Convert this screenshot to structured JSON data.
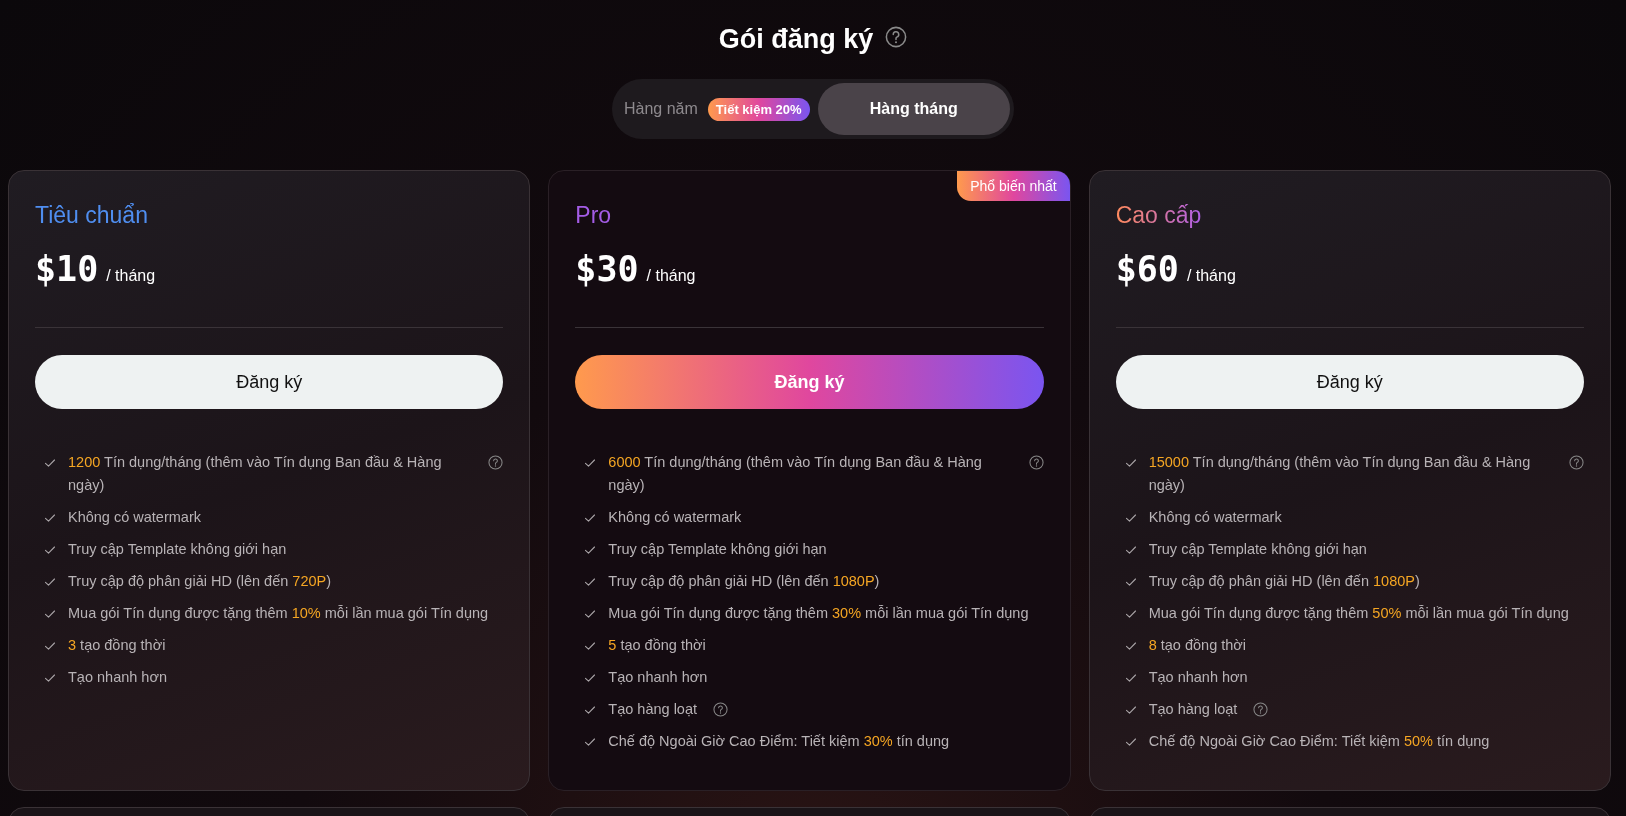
{
  "title": "Gói đăng ký",
  "billing_toggle": [
    {
      "label": "Hàng năm",
      "selected": false,
      "badge": "Tiết kiệm 20%"
    },
    {
      "label": "Hàng tháng",
      "selected": true
    }
  ],
  "plans": [
    {
      "name": "Tiêu chuẩn",
      "kind": "standard",
      "price": "$10",
      "period": "/ tháng",
      "featured": false,
      "button": "Đăng ký",
      "features": [
        {
          "segments": [
            {
              "text": "1200",
              "accent": true
            },
            {
              "text": " Tín dụng/tháng (thêm vào Tín dụng Ban đầu & Hàng ngày)",
              "accent": false
            }
          ],
          "help": true
        },
        {
          "segments": [
            {
              "text": "Không có watermark",
              "accent": false
            }
          ],
          "help": false
        },
        {
          "segments": [
            {
              "text": "Truy cập Template không giới hạn",
              "accent": false
            }
          ],
          "help": false
        },
        {
          "segments": [
            {
              "text": "Truy cập độ phân giải HD (lên đến ",
              "accent": false
            },
            {
              "text": "720P",
              "accent": true
            },
            {
              "text": ")",
              "accent": false
            }
          ],
          "help": false
        },
        {
          "segments": [
            {
              "text": "Mua gói Tín dụng được tặng thêm ",
              "accent": false
            },
            {
              "text": "10%",
              "accent": true
            },
            {
              "text": " mỗi lần mua gói Tín dụng",
              "accent": false
            }
          ],
          "help": false
        },
        {
          "segments": [
            {
              "text": "3",
              "accent": true
            },
            {
              "text": " tạo đồng thời",
              "accent": false
            }
          ],
          "help": false
        },
        {
          "segments": [
            {
              "text": "Tạo nhanh hơn",
              "accent": false
            }
          ],
          "help": false
        }
      ]
    },
    {
      "name": "Pro",
      "kind": "pro",
      "price": "$30",
      "period": "/ tháng",
      "featured": true,
      "badge": "Phổ biến nhất",
      "button": "Đăng ký",
      "features": [
        {
          "segments": [
            {
              "text": "6000",
              "accent": true
            },
            {
              "text": " Tín dụng/tháng (thêm vào Tín dụng Ban đầu & Hàng ngày)",
              "accent": false
            }
          ],
          "help": true
        },
        {
          "segments": [
            {
              "text": "Không có watermark",
              "accent": false
            }
          ],
          "help": false
        },
        {
          "segments": [
            {
              "text": "Truy cập Template không giới hạn",
              "accent": false
            }
          ],
          "help": false
        },
        {
          "segments": [
            {
              "text": "Truy cập độ phân giải HD (lên đến ",
              "accent": false
            },
            {
              "text": "1080P",
              "accent": true
            },
            {
              "text": ")",
              "accent": false
            }
          ],
          "help": false
        },
        {
          "segments": [
            {
              "text": "Mua gói Tín dụng được tặng thêm ",
              "accent": false
            },
            {
              "text": "30%",
              "accent": true
            },
            {
              "text": " mỗi lần mua gói Tín dụng",
              "accent": false
            }
          ],
          "help": false
        },
        {
          "segments": [
            {
              "text": "5",
              "accent": true
            },
            {
              "text": " tạo đồng thời",
              "accent": false
            }
          ],
          "help": false
        },
        {
          "segments": [
            {
              "text": "Tạo nhanh hơn",
              "accent": false
            }
          ],
          "help": false
        },
        {
          "segments": [
            {
              "text": "Tạo hàng loạt",
              "accent": false
            }
          ],
          "help": true
        },
        {
          "segments": [
            {
              "text": "Chế độ Ngoài Giờ Cao Điểm: Tiết kiệm ",
              "accent": false
            },
            {
              "text": "30%",
              "accent": true
            },
            {
              "text": " tín dụng",
              "accent": false
            }
          ],
          "help": false
        }
      ]
    },
    {
      "name": "Cao cấp",
      "kind": "premium",
      "price": "$60",
      "period": "/ tháng",
      "featured": false,
      "button": "Đăng ký",
      "features": [
        {
          "segments": [
            {
              "text": "15000",
              "accent": true
            },
            {
              "text": " Tín dụng/tháng (thêm vào Tín dụng Ban đầu & Hàng ngày)",
              "accent": false
            }
          ],
          "help": true
        },
        {
          "segments": [
            {
              "text": "Không có watermark",
              "accent": false
            }
          ],
          "help": false
        },
        {
          "segments": [
            {
              "text": "Truy cập Template không giới hạn",
              "accent": false
            }
          ],
          "help": false
        },
        {
          "segments": [
            {
              "text": "Truy cập độ phân giải HD (lên đến ",
              "accent": false
            },
            {
              "text": "1080P",
              "accent": true
            },
            {
              "text": ")",
              "accent": false
            }
          ],
          "help": false
        },
        {
          "segments": [
            {
              "text": "Mua gói Tín dụng được tặng thêm ",
              "accent": false
            },
            {
              "text": "50%",
              "accent": true
            },
            {
              "text": " mỗi lần mua gói Tín dụng",
              "accent": false
            }
          ],
          "help": false
        },
        {
          "segments": [
            {
              "text": "8",
              "accent": true
            },
            {
              "text": " tạo đồng thời",
              "accent": false
            }
          ],
          "help": false
        },
        {
          "segments": [
            {
              "text": "Tạo nhanh hơn",
              "accent": false
            }
          ],
          "help": false
        },
        {
          "segments": [
            {
              "text": "Tạo hàng loạt",
              "accent": false
            }
          ],
          "help": true
        },
        {
          "segments": [
            {
              "text": "Chế độ Ngoài Giờ Cao Điểm: Tiết kiệm ",
              "accent": false
            },
            {
              "text": "50%",
              "accent": true
            },
            {
              "text": " tín dụng",
              "accent": false
            }
          ],
          "help": false
        }
      ]
    }
  ]
}
